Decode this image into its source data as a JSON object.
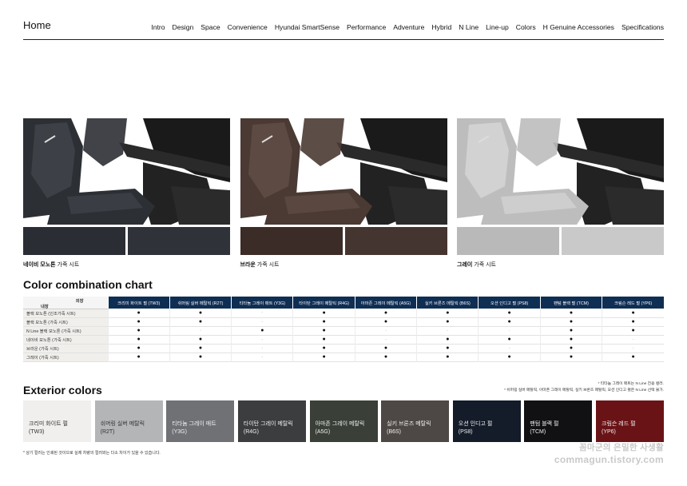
{
  "nav": {
    "home": "Home",
    "links": [
      "Intro",
      "Design",
      "Space",
      "Convenience",
      "Hyundai SmartSense",
      "Performance",
      "Adventure",
      "Hybrid",
      "N Line",
      "Line-up",
      "Colors",
      "H Genuine Accessories",
      "Specifications"
    ]
  },
  "interiors": [
    {
      "name": "네이비 모노톤",
      "suffix": " 가죽 시트",
      "seat": "#2c2f34",
      "seat_hi": "#4c5058",
      "sw1": "#2a2d33",
      "sw2": "#2f3238"
    },
    {
      "name": "브라운",
      "suffix": " 가죽 시트",
      "seat": "#4a3a33",
      "seat_hi": "#6e5950",
      "sw1": "#3b2c27",
      "sw2": "#453530"
    },
    {
      "name": "그레이",
      "suffix": " 가죽 시트",
      "seat": "#bdbdbd",
      "seat_hi": "#e3e3e3",
      "sw1": "#b9b9b9",
      "sw2": "#c9c9c9"
    }
  ],
  "chart": {
    "title": "Color combination chart",
    "diag_exterior": "외장",
    "diag_interior": "내장",
    "columns": [
      "크리미 화이트 펄 (TW3)",
      "쉬머링 실버 메탈릭 (R2T)",
      "티타늄 그레이 매트 (Y3G)",
      "타이탄 그레이 메탈릭 (R4G)",
      "아마존 그레이 메탈릭 (A5G)",
      "실키 브론즈 메탈릭 (B6S)",
      "오션 인디고 펄 (PS8)",
      "팬텀 블랙 펄 (TCM)",
      "크림슨 레드 펄 (YP6)"
    ],
    "rows": [
      {
        "label": "블랙 모노톤 (인조가죽 시트)",
        "cells": [
          "●",
          "●",
          "-",
          "●",
          "●",
          "●",
          "●",
          "●",
          "●"
        ]
      },
      {
        "label": "블랙 모노톤 (가죽 시트)",
        "cells": [
          "●",
          "●",
          "-",
          "●",
          "●",
          "●",
          "●",
          "●",
          "●"
        ]
      },
      {
        "label": "N Line 블랙 모노톤 (가죽 시트)",
        "cells": [
          "●",
          "-",
          "●",
          "●",
          "-",
          "-",
          "-",
          "●",
          "●"
        ]
      },
      {
        "label": "네이비 모노톤 (가죽 시트)",
        "cells": [
          "●",
          "●",
          "-",
          "●",
          "-",
          "●",
          "●",
          "●",
          "-"
        ]
      },
      {
        "label": "브라운 (가죽 시트)",
        "cells": [
          "●",
          "●",
          "-",
          "●",
          "●",
          "●",
          "-",
          "●",
          "-"
        ]
      },
      {
        "label": "그레이 (가죽 시트)",
        "cells": [
          "●",
          "●",
          "-",
          "●",
          "●",
          "●",
          "●",
          "●",
          "●"
        ]
      }
    ]
  },
  "notes": {
    "line1": "* 티타늄 그레이 매트는 N Line 전용 컬러.",
    "line2": "* 쉬머링 실버 메탈릭, 아마존 그레이 메탈릭, 실키 브론즈 메탈릭, 오션 인디고 펄은 N Line 선택 불가."
  },
  "exterior": {
    "title": "Exterior colors",
    "colors": [
      {
        "name": "크리미 화이트 펄",
        "code": "(TW3)",
        "bg": "#f0efed",
        "fg": "#333333"
      },
      {
        "name": "쉬머링 실버 메탈릭",
        "code": "(R2T)",
        "bg": "#b4b5b7",
        "fg": "#333333"
      },
      {
        "name": "티타늄 그레이 매트",
        "code": "(Y3G)",
        "bg": "#6f7175",
        "fg": "#f0f0f0"
      },
      {
        "name": "타이탄 그레이 메탈릭",
        "code": "(R4G)",
        "bg": "#3c3d3f",
        "fg": "#f0f0f0"
      },
      {
        "name": "아마존 그레이 메탈릭",
        "code": "(A5G)",
        "bg": "#3a3f37",
        "fg": "#f0f0f0"
      },
      {
        "name": "실키 브론즈 메탈릭",
        "code": "(B6S)",
        "bg": "#4d4845",
        "fg": "#f0f0f0"
      },
      {
        "name": "오션 인디고 펄",
        "code": "(PS8)",
        "bg": "#141c29",
        "fg": "#f0f0f0"
      },
      {
        "name": "팬텀 블랙 펄",
        "code": "(TCM)",
        "bg": "#111113",
        "fg": "#f0f0f0"
      },
      {
        "name": "크림슨 레드 펄",
        "code": "(YP6)",
        "bg": "#6a1316",
        "fg": "#f0f0f0"
      }
    ]
  },
  "footnote": "* 상기 컬러는 인쇄된 것이므로 실제 차량의 컬러와는 다소 차이가 있을 수 있습니다.",
  "watermark": {
    "line1": "꼼마군의 은밀한 사생활",
    "line2": "commagun.tistory.com"
  }
}
